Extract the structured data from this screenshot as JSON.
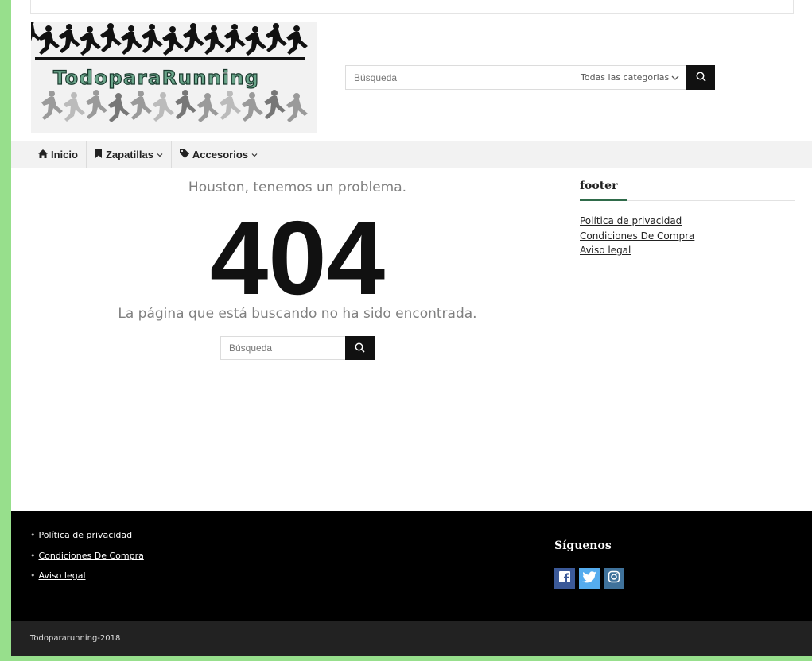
{
  "brand": {
    "logo_text": "TodoparaRunning"
  },
  "header_search": {
    "placeholder": "Búsqueda",
    "category_selected": "Todas las categorias"
  },
  "nav": {
    "items": [
      {
        "label": "Inicio",
        "icon": "home-icon",
        "has_dropdown": false
      },
      {
        "label": "Zapatillas",
        "icon": "bookmark-icon",
        "has_dropdown": true
      },
      {
        "label": "Accesorios",
        "icon": "tag-icon",
        "has_dropdown": true
      }
    ]
  },
  "error": {
    "subtitle": "Houston, tenemos un problema.",
    "code": "404",
    "message": "La página que está buscando no ha sido encontrada.",
    "search_placeholder": "Búsqueda"
  },
  "sidebar": {
    "title": "footer",
    "links": [
      "Política de privacidad",
      "Condiciones De Compra",
      "Aviso legal"
    ]
  },
  "footer": {
    "links": [
      "Política de privacidad",
      "Condiciones De Compra",
      "Aviso legal"
    ],
    "follow_title": "Síguenos",
    "social": [
      {
        "name": "facebook-icon",
        "color": "#3b5998"
      },
      {
        "name": "twitter-icon",
        "color": "#55acee"
      },
      {
        "name": "instagram-icon",
        "color": "#3f729b"
      }
    ],
    "copyright": "Todopararunning-2018"
  },
  "colors": {
    "outer_bg": "#97df8c",
    "accent": "#2f6b4a",
    "footer_bg": "#000000",
    "bottombar_bg": "#222222"
  }
}
